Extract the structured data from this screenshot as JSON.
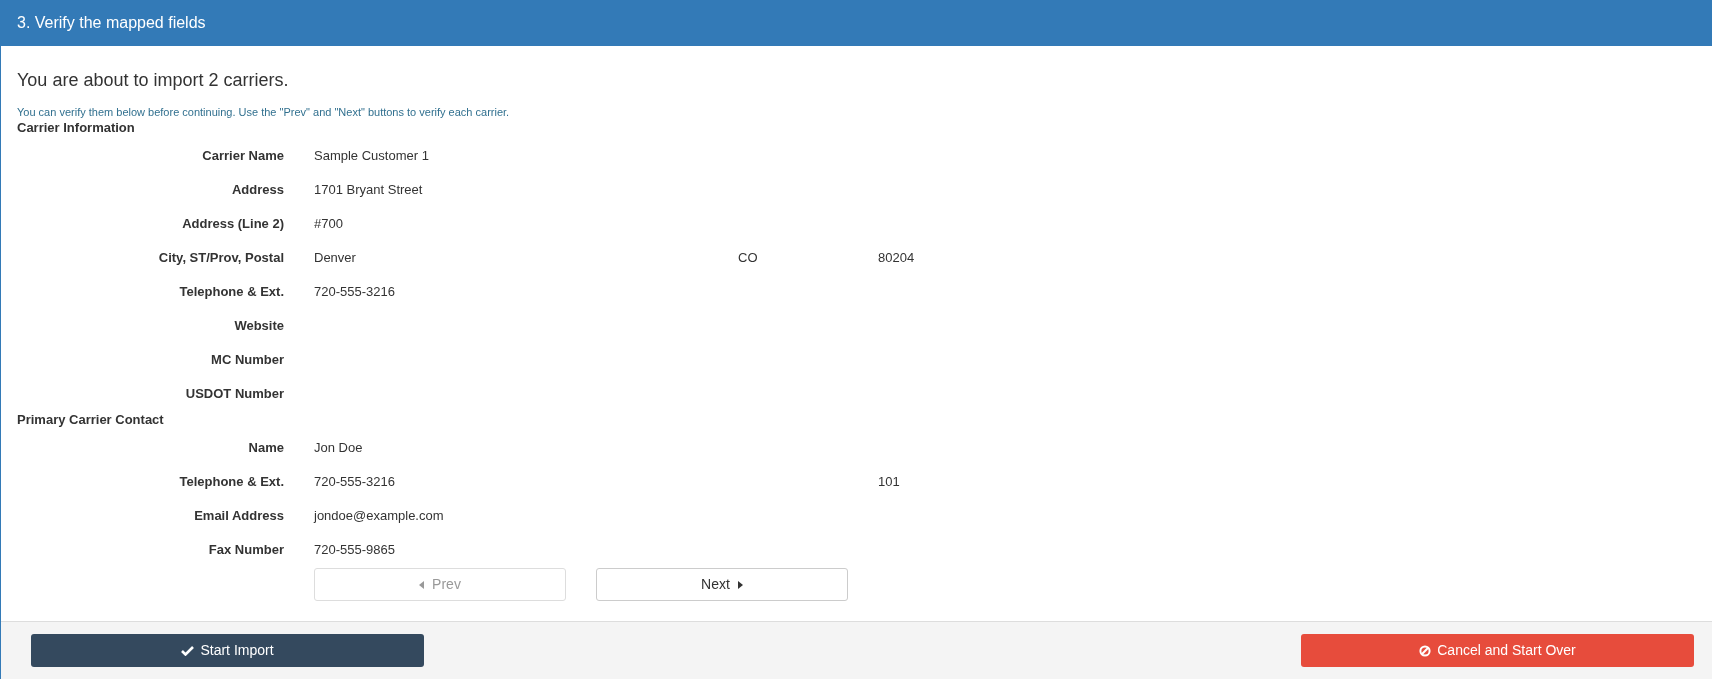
{
  "panel": {
    "title": "3. Verify the mapped fields"
  },
  "heading": "You are about to import 2 carriers.",
  "intro": "You can verify them below before continuing. Use the \"Prev\" and \"Next\" buttons to verify each carrier.",
  "sections": [
    {
      "title": "Carrier Information",
      "rows": [
        {
          "label": "Carrier Name",
          "value": "Sample Customer 1"
        },
        {
          "label": "Address",
          "value": "1701 Bryant Street"
        },
        {
          "label": "Address (Line 2)",
          "value": "#700"
        },
        {
          "label": "City, ST/Prov, Postal",
          "value": "Denver",
          "column_2": "CO",
          "column_3": "80204"
        },
        {
          "label": "Telephone & Ext.",
          "value": "720-555-3216"
        },
        {
          "label": "Website"
        },
        {
          "label": "MC Number"
        },
        {
          "label": "USDOT Number"
        }
      ]
    },
    {
      "title": "Primary Carrier Contact",
      "rows": [
        {
          "label": "Name",
          "value": "Jon Doe"
        },
        {
          "label": "Telephone & Ext.",
          "value": "720-555-3216",
          "column_3": "101"
        },
        {
          "label": "Email Address",
          "value": "jondoe@example.com"
        },
        {
          "label": "Fax Number",
          "value": "720-555-9865"
        }
      ]
    }
  ],
  "pager": {
    "prev": {
      "label": "Prev",
      "disabled": true
    },
    "next": {
      "label": "Next",
      "disabled": false
    }
  },
  "footer": {
    "start": "Start Import",
    "cancel": "Cancel and Start Over"
  }
}
